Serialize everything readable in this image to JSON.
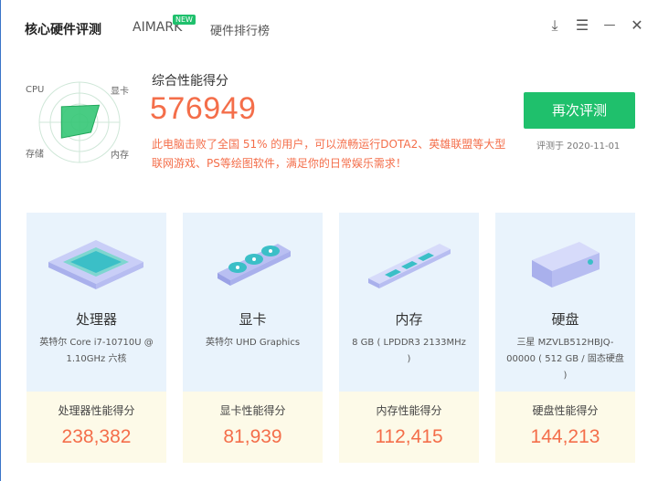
{
  "tabs": [
    {
      "label": "核心硬件评测",
      "active": true
    },
    {
      "label": "AIMARK",
      "badge": "NEW"
    },
    {
      "label": "硬件排行榜"
    }
  ],
  "window_controls": {
    "download": "⤓",
    "menu": "☰",
    "minimize": "—",
    "close": "✕"
  },
  "radar": {
    "labels": {
      "cpu": "CPU",
      "gpu": "显卡",
      "memory": "内存",
      "storage": "存储"
    },
    "values": {
      "cpu": 0.55,
      "gpu": 0.6,
      "memory": 0.35,
      "storage": 0.55
    }
  },
  "overall": {
    "title": "综合性能得分",
    "score": "576949",
    "description": "此电脑击败了全国 51% 的用户，可以流畅运行DOTA2、英雄联盟等大型联网游戏、PS等绘图软件，满足你的日常娱乐需求！"
  },
  "retest_button": "再次评测",
  "test_date": "评测于 2020-11-01",
  "cards": [
    {
      "name": "处理器",
      "desc": "英特尔 Core i7-10710U @ 1.10GHz 六核",
      "score_label": "处理器性能得分",
      "score": "238,382",
      "icon": "cpu-chip-icon"
    },
    {
      "name": "显卡",
      "desc": "英特尔 UHD Graphics",
      "score_label": "显卡性能得分",
      "score": "81,939",
      "icon": "graphics-card-icon"
    },
    {
      "name": "内存",
      "desc": "8 GB ( LPDDR3 2133MHz )",
      "score_label": "内存性能得分",
      "score": "112,415",
      "icon": "memory-stick-icon"
    },
    {
      "name": "硬盘",
      "desc": "三星 MZVLB512HBJQ-00000 ( 512 GB / 固态硬盘 )",
      "score_label": "硬盘性能得分",
      "score": "144,213",
      "icon": "hard-drive-icon"
    }
  ],
  "colors": {
    "accent_green": "#1fc06c",
    "score_orange": "#f46e4a",
    "card_blue": "#e9f3fc",
    "card_cream": "#fdfae8"
  }
}
